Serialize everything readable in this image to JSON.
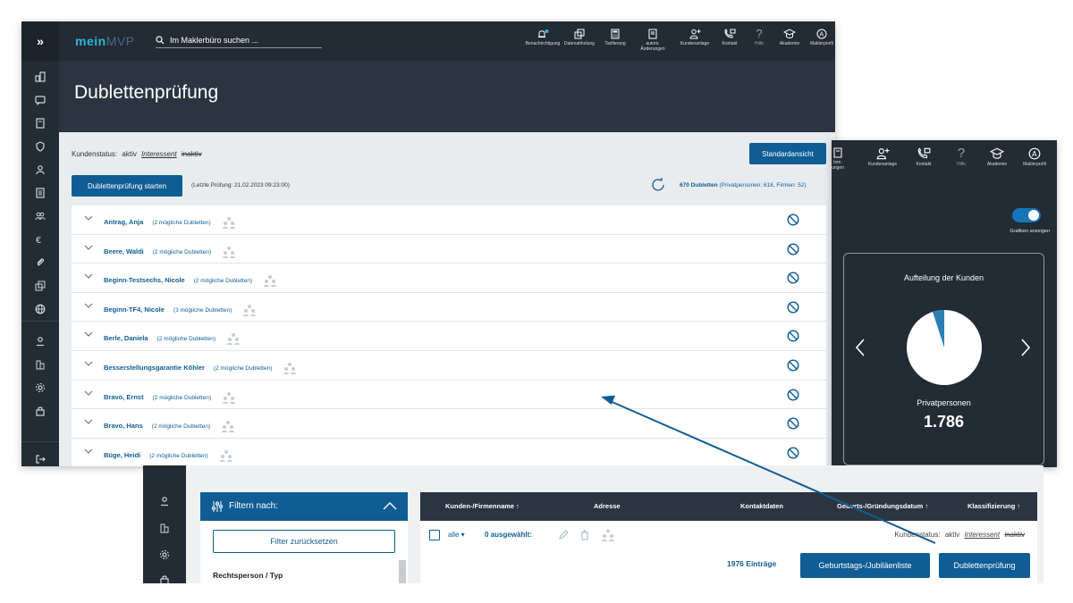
{
  "app": {
    "logo_part1": "mein",
    "logo_part2": "MVP",
    "search_placeholder": "Im Maklerbüro suchen ..."
  },
  "toolbar": [
    {
      "label": "Benachrichtigung",
      "icon": "bell-icon"
    },
    {
      "label": "Datenabholung",
      "icon": "data-fetch-icon"
    },
    {
      "label": "Tarifierung",
      "icon": "calculator-icon"
    },
    {
      "label": "autom. Änderungen",
      "icon": "auto-changes-icon"
    },
    {
      "label": "Kundenanlage",
      "icon": "add-customer-icon"
    },
    {
      "label": "Kontakt",
      "icon": "phone-icon"
    },
    {
      "label": "Hilfe",
      "icon": "help-icon"
    },
    {
      "label": "Akademie",
      "icon": "graduation-cap-icon"
    },
    {
      "label": "Maklerprofil",
      "icon": "profile-icon"
    }
  ],
  "page": {
    "title": "Dublettenprüfung",
    "status_label": "Kundenstatus:",
    "status_active": "aktiv",
    "status_interessent": "Interessent",
    "status_inactive": "inaktiv",
    "standard_view_button": "Standardansicht",
    "start_button": "Dublettenprüfung starten",
    "last_check": "(Letzte Prüfung: 21.02.2023 09:23:00)",
    "dup_count_bold": "670 Dubletten",
    "dup_count_detail": "(Privatpersonen: 618, Firmen: 52)"
  },
  "duplicates": [
    {
      "name": "Antrag, Anja",
      "count": "(2 mögliche Dubletten)"
    },
    {
      "name": "Beere, Waldi",
      "count": "(2 mögliche Dubletten)"
    },
    {
      "name": "Beginn-Testsechs, Nicole",
      "count": "(2 mögliche Dubletten)"
    },
    {
      "name": "Beginn-TF4, Nicole",
      "count": "(3 mögliche Dubletten)"
    },
    {
      "name": "Berle, Daniela",
      "count": "(2 mögliche Dubletten)"
    },
    {
      "name": "Besserstellungsgarantie Köhler",
      "count": "(2 mögliche Dubletten)"
    },
    {
      "name": "Bravo, Ernst",
      "count": "(2 mögliche Dubletten)"
    },
    {
      "name": "Bravo, Hans",
      "count": "(2 mögliche Dubletten)"
    },
    {
      "name": "Büge, Heidi",
      "count": "(2 mögliche Dubletten)"
    }
  ],
  "right_panel": {
    "toolbar_partial": [
      "tom.",
      "ungen"
    ],
    "toolbar": [
      {
        "label": "Kundenanlage",
        "icon": "add-customer-icon"
      },
      {
        "label": "Kontakt",
        "icon": "phone-icon"
      },
      {
        "label": "Hilfe",
        "icon": "help-icon"
      },
      {
        "label": "Akademie",
        "icon": "graduation-cap-icon"
      },
      {
        "label": "Maklerprofil",
        "icon": "profile-icon"
      }
    ],
    "toggle_label": "Grafiken anzeigen",
    "toggle_on": true,
    "card_title": "Aufteilung der Kunden",
    "card_subtitle": "Privatpersonen",
    "card_value": "1.786",
    "pie": {
      "major_share": 0.95,
      "major_color": "#ffffff",
      "minor_color": "#2d7fb3"
    }
  },
  "bottom_panel": {
    "filter_title": "Filtern nach:",
    "filter_reset": "Filter zurücksetzen",
    "filter_section": "Rechtsperson / Typ",
    "columns": [
      "Kunden-/Firmenname ↑",
      "Adresse",
      "Kontaktdaten",
      "Geburts-/Gründungsdatum ↑",
      "Klassifizierung ↑"
    ],
    "select_all": "alle",
    "selected": "0 ausgewählt:",
    "status_label": "Kundenstatus:",
    "status_active": "aktiv",
    "status_interessent": "Interessent",
    "status_inactive": "inaktiv",
    "entries": "1976 Einträge",
    "birthday_button": "Geburtstags-/Jubiläenliste",
    "dup_button": "Dublettenprüfung"
  },
  "colors": {
    "accent": "#0f5d94",
    "dark": "#232b35",
    "arrow": "#0f5d94"
  }
}
